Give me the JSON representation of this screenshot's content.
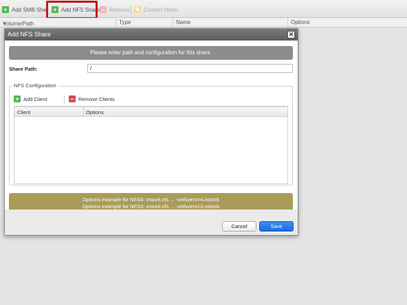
{
  "toolbar": {
    "add_smb_label": "Add SMB Shar",
    "add_nfs_label": "Add NFS Share",
    "remove_label": "Remove",
    "context_menu_label": "Context Menu"
  },
  "columns": {
    "volume_path": "Volume/Path",
    "sort_indicator": "▲",
    "type": "Type",
    "name": "Name",
    "options": "Options"
  },
  "dialog": {
    "title": "Add NFS Share",
    "close_glyph": "✕",
    "info_text": "Please enter path and configuration for this share.",
    "share_path_label": "Share Path:",
    "share_path_value": "/",
    "nfs_config_legend": "NFS Configuration",
    "add_client_label": "Add Client",
    "remove_clients_label": "Remove Clients",
    "grid_columns": [
      "Client",
      "Options"
    ],
    "note_line1": "Options example for NFS4: mount.nfs ... -onfsvers=4,nolock",
    "note_line2": "Options example for NFS3: mount.nfs ... -onfsvers=3,nolock",
    "cancel_label": "Cancel",
    "save_label": "Save"
  },
  "icons": {
    "add": "plus-icon",
    "remove": "minus-icon",
    "context": "context-menu-icon",
    "close": "close-icon"
  },
  "colors": {
    "highlight": "#c0191b",
    "save_button": "#1a6ee0",
    "note_background": "#a99c5a",
    "info_background": "#8c8c8c",
    "add_icon": "#56b556",
    "remove_icon": "#d05050"
  }
}
